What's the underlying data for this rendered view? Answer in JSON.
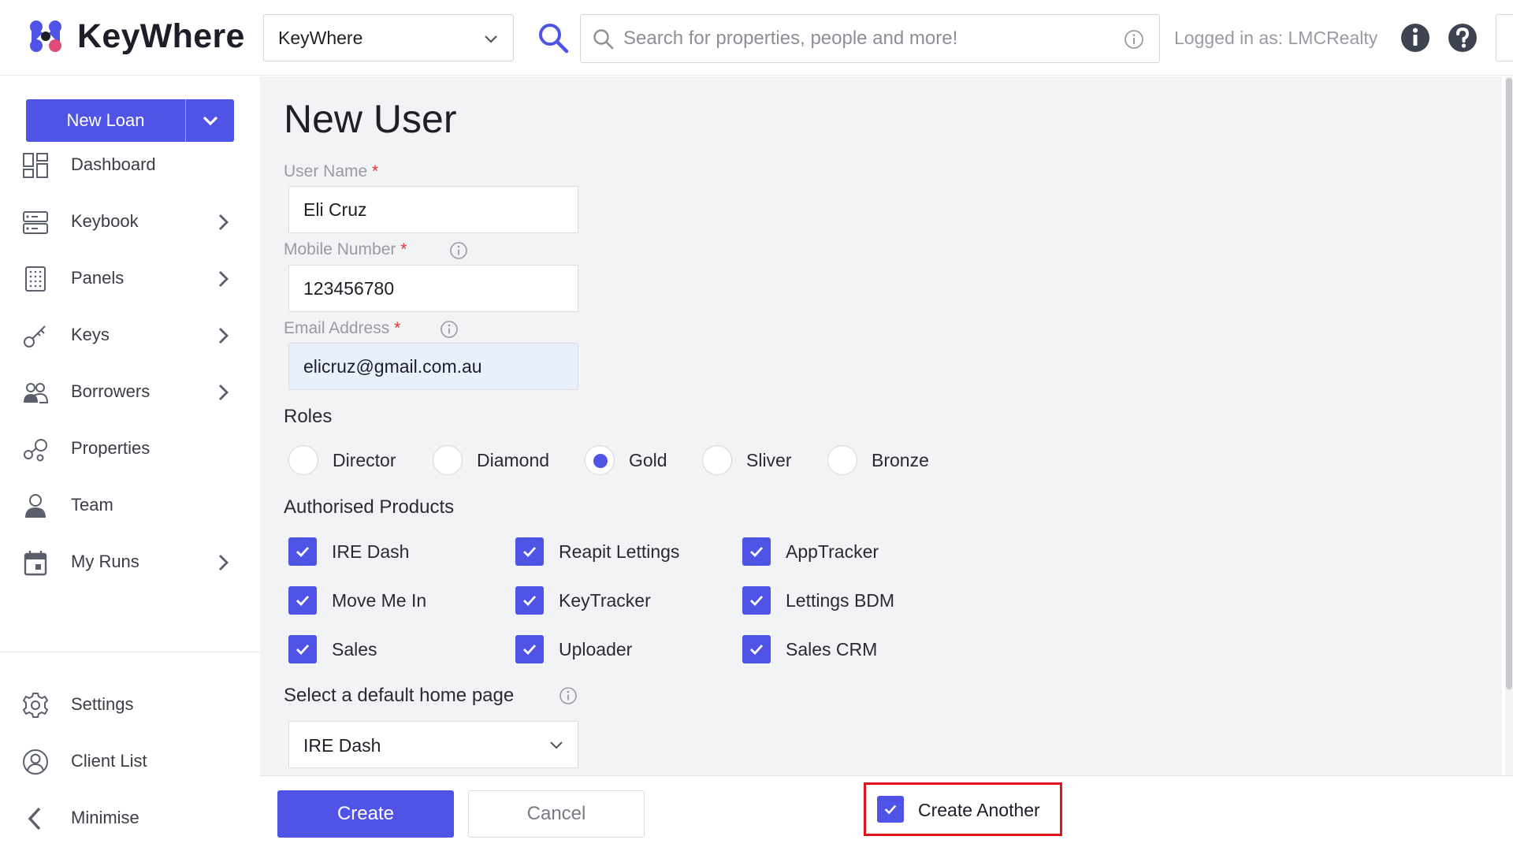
{
  "app": {
    "name": "KeyWhere"
  },
  "header": {
    "org_select_value": "KeyWhere",
    "search_placeholder": "Search for properties, people and more!",
    "logged_in_text": "Logged in as: LMCRealty"
  },
  "sidebar": {
    "new_loan_label": "New Loan",
    "items": [
      {
        "label": "Dashboard",
        "icon": "dashboard-icon",
        "has_submenu": false
      },
      {
        "label": "Keybook",
        "icon": "keybook-icon",
        "has_submenu": true
      },
      {
        "label": "Panels",
        "icon": "panels-icon",
        "has_submenu": true
      },
      {
        "label": "Keys",
        "icon": "key-icon",
        "has_submenu": true
      },
      {
        "label": "Borrowers",
        "icon": "people-icon",
        "has_submenu": true
      },
      {
        "label": "Properties",
        "icon": "properties-icon",
        "has_submenu": false
      },
      {
        "label": "Team",
        "icon": "person-icon",
        "has_submenu": false
      },
      {
        "label": "My Runs",
        "icon": "calendar-icon",
        "has_submenu": true
      }
    ],
    "bottom_items": [
      {
        "label": "Settings",
        "icon": "gear-icon"
      },
      {
        "label": "Client List",
        "icon": "user-circle-icon"
      },
      {
        "label": "Minimise",
        "icon": "chevron-left-icon"
      }
    ]
  },
  "form": {
    "title": "New User",
    "user_name": {
      "label": "User Name",
      "value": "Eli Cruz"
    },
    "mobile": {
      "label": "Mobile Number",
      "value": "123456780"
    },
    "email": {
      "label": "Email Address",
      "value": "elicruz@gmail.com.au"
    },
    "required_mark": "*",
    "roles": {
      "title": "Roles",
      "options": [
        "Director",
        "Diamond",
        "Gold",
        "Sliver",
        "Bronze"
      ],
      "selected": "Gold"
    },
    "products": {
      "title": "Authorised Products",
      "items": [
        {
          "label": "IRE Dash",
          "checked": true
        },
        {
          "label": "Reapit Lettings",
          "checked": true
        },
        {
          "label": "AppTracker",
          "checked": true
        },
        {
          "label": "Move Me In",
          "checked": true
        },
        {
          "label": "KeyTracker",
          "checked": true
        },
        {
          "label": "Lettings BDM",
          "checked": true
        },
        {
          "label": "Sales",
          "checked": true
        },
        {
          "label": "Uploader",
          "checked": true
        },
        {
          "label": "Sales CRM",
          "checked": true
        }
      ]
    },
    "home_page": {
      "label": "Select a default home page",
      "value": "IRE Dash"
    }
  },
  "footer": {
    "create_label": "Create",
    "cancel_label": "Cancel",
    "create_another_label": "Create Another",
    "create_another_checked": true
  },
  "colors": {
    "accent": "#4f54e6",
    "highlight_border": "#e1141b"
  }
}
